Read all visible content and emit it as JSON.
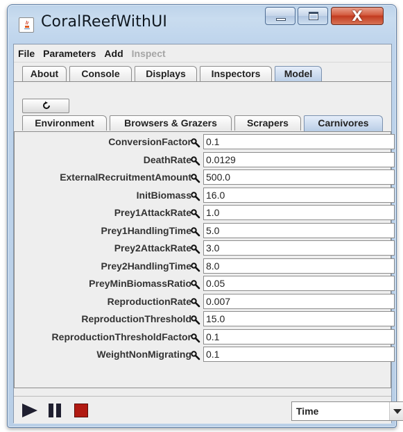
{
  "window": {
    "title": "CoralReefWithUI"
  },
  "menu": {
    "items": [
      {
        "label": "File",
        "enabled": true
      },
      {
        "label": "Parameters",
        "enabled": true
      },
      {
        "label": "Add",
        "enabled": true
      },
      {
        "label": "Inspect",
        "enabled": false
      }
    ]
  },
  "main_tabs": {
    "items": [
      "About",
      "Console",
      "Displays",
      "Inspectors",
      "Model"
    ],
    "selected": "Model"
  },
  "sub_tabs": {
    "items": [
      "Environment",
      "Browsers & Grazers",
      "Scrapers",
      "Carnivores"
    ],
    "selected": "Carnivores"
  },
  "properties": [
    {
      "name": "ConversionFactor",
      "value": "0.1"
    },
    {
      "name": "DeathRate",
      "value": "0.0129"
    },
    {
      "name": "ExternalRecruitmentAmount",
      "value": "500.0"
    },
    {
      "name": "InitBiomass",
      "value": "16.0"
    },
    {
      "name": "Prey1AttackRate",
      "value": "1.0"
    },
    {
      "name": "Prey1HandlingTime",
      "value": "5.0"
    },
    {
      "name": "Prey2AttackRate",
      "value": "3.0"
    },
    {
      "name": "Prey2HandlingTime",
      "value": "8.0"
    },
    {
      "name": "PreyMinBiomassRatio",
      "value": "0.05"
    },
    {
      "name": "ReproductionRate",
      "value": "0.007"
    },
    {
      "name": "ReproductionThreshold",
      "value": "15.0"
    },
    {
      "name": "ReproductionThresholdFactor",
      "value": "0.1"
    },
    {
      "name": "WeightNonMigrating",
      "value": "0.1"
    }
  ],
  "controls": {
    "time_select": "Time"
  },
  "icons": {
    "app": "java-cup-icon",
    "refresh": "refresh-icon",
    "property": "magnifier-icon",
    "play": "play-icon",
    "pause": "pause-icon",
    "stop": "stop-icon"
  },
  "colors": {
    "stop": "#b11a12",
    "selected_tab": "#b8cde6"
  }
}
